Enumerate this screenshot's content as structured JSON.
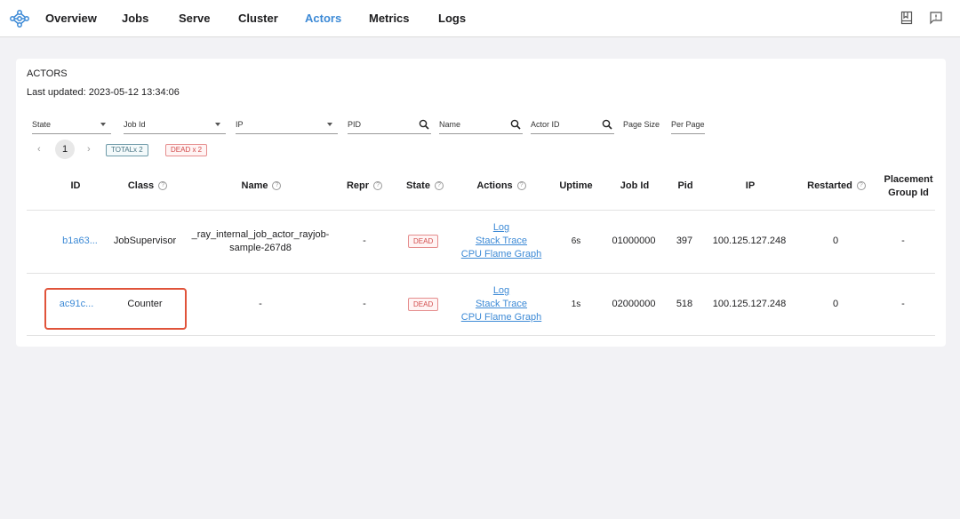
{
  "nav": {
    "items": [
      {
        "label": "Overview",
        "active": false
      },
      {
        "label": "Jobs",
        "active": false
      },
      {
        "label": "Serve",
        "active": false
      },
      {
        "label": "Cluster",
        "active": false
      },
      {
        "label": "Actors",
        "active": true
      },
      {
        "label": "Metrics",
        "active": false
      },
      {
        "label": "Logs",
        "active": false
      }
    ],
    "accent_color": "#3d8ad6",
    "right_icons": [
      "book-icon",
      "feedback-icon"
    ]
  },
  "actors": {
    "title": "ACTORS",
    "last_updated": "Last updated: 2023-05-12 13:34:06",
    "filters": {
      "state": "State",
      "job_id": "Job Id",
      "ip": "IP",
      "pid": "PID",
      "name": "Name",
      "actor_id": "Actor ID",
      "page_size": "Page Size",
      "per_page": "Per Page"
    },
    "pagination": {
      "current_page": "1",
      "total_tag": "TOTALx 2",
      "dead_tag": "DEAD x 2"
    },
    "columns": {
      "id": "ID",
      "class": "Class",
      "name": "Name",
      "repr": "Repr",
      "state": "State",
      "actions": "Actions",
      "uptime": "Uptime",
      "job_id": "Job Id",
      "pid": "Pid",
      "ip": "IP",
      "restarted": "Restarted",
      "placement_line1": "Placement",
      "placement_line2": "Group Id"
    },
    "rows": [
      {
        "id": "b1a63...",
        "class": "JobSupervisor",
        "name_line1": "_ray_internal_job_actor_rayjob-",
        "name_line2": "sample-267d8",
        "repr": "-",
        "state": "DEAD",
        "action_log": "Log",
        "action_stack": "Stack Trace",
        "action_flame": "CPU Flame Graph",
        "uptime": "6s",
        "job_id": "01000000",
        "pid": "397",
        "ip": "100.125.127.248",
        "restarted": "0",
        "placement": "-"
      },
      {
        "id": "ac91c...",
        "class": "Counter",
        "name_line1": "-",
        "repr": "-",
        "state": "DEAD",
        "action_log": "Log",
        "action_stack": "Stack Trace",
        "action_flame": "CPU Flame Graph",
        "uptime": "1s",
        "job_id": "02000000",
        "pid": "518",
        "ip": "100.125.127.248",
        "restarted": "0",
        "placement": "-"
      }
    ]
  },
  "colors": {
    "highlight_box": "#e0533a",
    "dead": "#d24b4b"
  }
}
